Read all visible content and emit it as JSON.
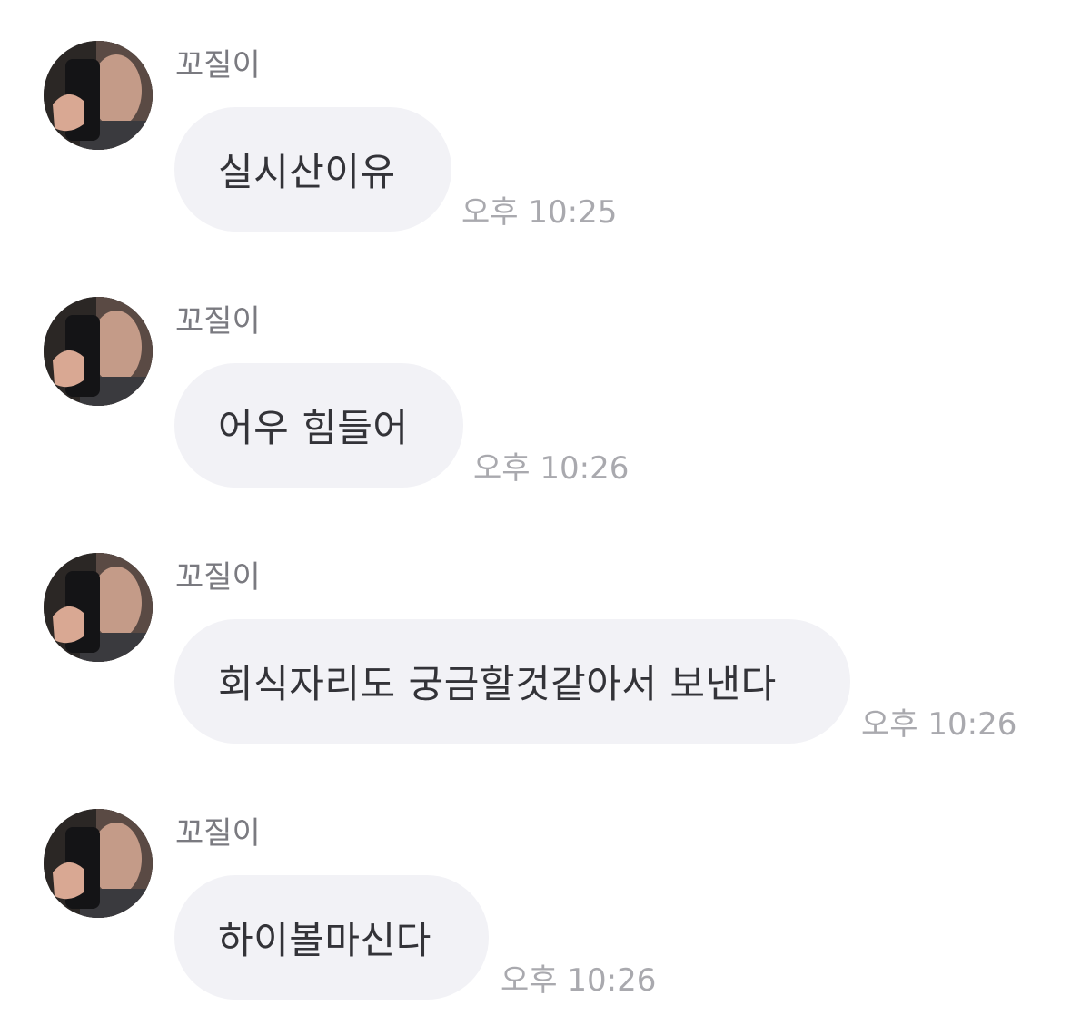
{
  "messages": [
    {
      "sender": "꼬질이",
      "text": "실시산이유",
      "time": "오후 10:25"
    },
    {
      "sender": "꼬질이",
      "text": "어우 힘들어",
      "time": "오후 10:26"
    },
    {
      "sender": "꼬질이",
      "text": "회식자리도 궁금할것같아서 보낸다",
      "time": "오후 10:26"
    },
    {
      "sender": "꼬질이",
      "text": "하이볼마신다",
      "time": "오후 10:26"
    }
  ],
  "avatar_icon": "profile-photo-avatar",
  "colors": {
    "bubble_bg": "#f2f2f6",
    "bubble_text": "#333338",
    "sender_text": "#7a7a80",
    "time_text": "#a9a9ae"
  }
}
